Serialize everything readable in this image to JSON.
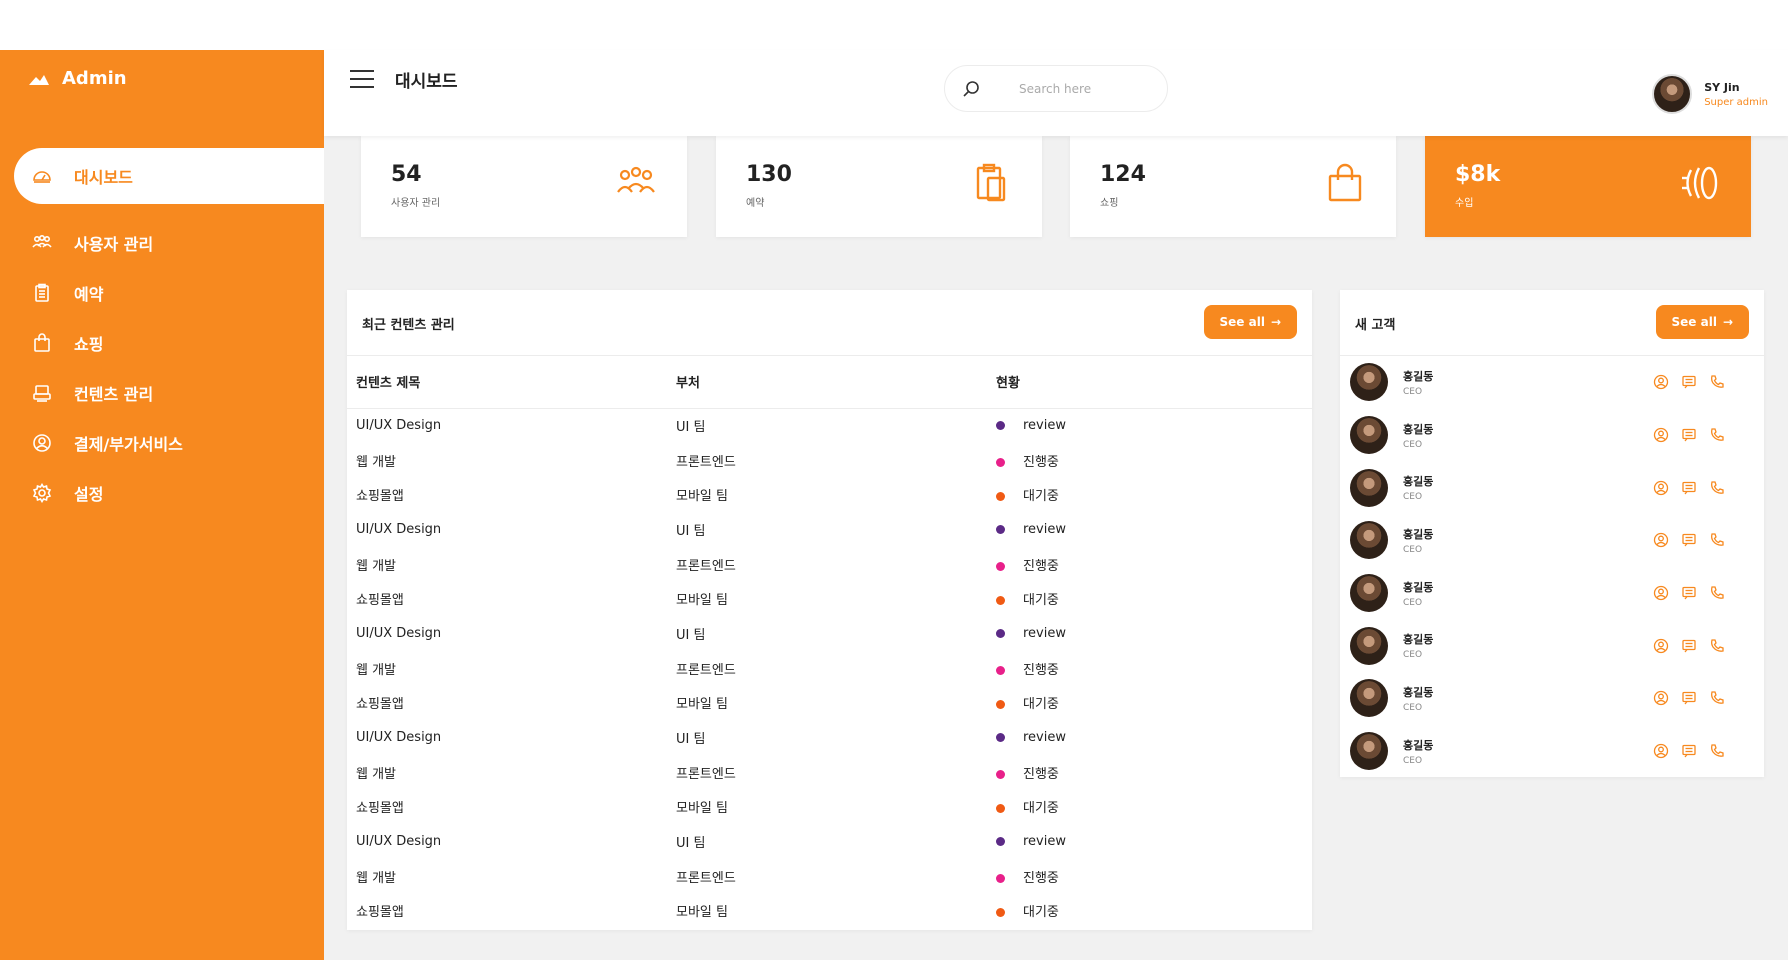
{
  "brand": {
    "name": "Admin"
  },
  "sidebar": {
    "items": [
      {
        "label": "대시보드",
        "icon": "dashboard-icon",
        "active": true
      },
      {
        "label": "사용자 관리",
        "icon": "users-icon"
      },
      {
        "label": "예약",
        "icon": "clipboard-icon"
      },
      {
        "label": "쇼핑",
        "icon": "shopping-bag-icon"
      },
      {
        "label": "컨텐츠 관리",
        "icon": "content-icon"
      },
      {
        "label": "결제/부가서비스",
        "icon": "user-circle-icon"
      },
      {
        "label": "설정",
        "icon": "gear-icon"
      }
    ]
  },
  "header": {
    "title": "대시보드",
    "search_placeholder": "Search here",
    "user_name": "SY Jin",
    "user_role": "Super admin"
  },
  "cards": [
    {
      "value": "54",
      "label": "사용자 관리",
      "icon": "users-icon"
    },
    {
      "value": "130",
      "label": "예약",
      "icon": "clipboard-icon"
    },
    {
      "value": "124",
      "label": "쇼핑",
      "icon": "shopping-bag-icon"
    },
    {
      "value": "$8k",
      "label": "수입",
      "icon": "coins-icon"
    }
  ],
  "recent": {
    "title": "최근 컨텐츠 관리",
    "see_all": "See all",
    "columns": [
      "컨텐츠 제목",
      "부처",
      "현황"
    ],
    "rows": [
      {
        "title": "UI/UX Design",
        "dept": "UI 팀",
        "status": "review",
        "color": "#5b2a86"
      },
      {
        "title": "웹 개발",
        "dept": "프론트엔드",
        "status": "진행중",
        "color": "#e8208a"
      },
      {
        "title": "쇼핑몰앱",
        "dept": "모바일 팀",
        "status": "대기중",
        "color": "#f05a14"
      },
      {
        "title": "UI/UX Design",
        "dept": "UI 팀",
        "status": "review",
        "color": "#5b2a86"
      },
      {
        "title": "웹 개발",
        "dept": "프론트엔드",
        "status": "진행중",
        "color": "#e8208a"
      },
      {
        "title": "쇼핑몰앱",
        "dept": "모바일 팀",
        "status": "대기중",
        "color": "#f05a14"
      },
      {
        "title": "UI/UX Design",
        "dept": "UI 팀",
        "status": "review",
        "color": "#5b2a86"
      },
      {
        "title": "웹 개발",
        "dept": "프론트엔드",
        "status": "진행중",
        "color": "#e8208a"
      },
      {
        "title": "쇼핑몰앱",
        "dept": "모바일 팀",
        "status": "대기중",
        "color": "#f05a14"
      },
      {
        "title": "UI/UX Design",
        "dept": "UI 팀",
        "status": "review",
        "color": "#5b2a86"
      },
      {
        "title": "웹 개발",
        "dept": "프론트엔드",
        "status": "진행중",
        "color": "#e8208a"
      },
      {
        "title": "쇼핑몰앱",
        "dept": "모바일 팀",
        "status": "대기중",
        "color": "#f05a14"
      },
      {
        "title": "UI/UX Design",
        "dept": "UI 팀",
        "status": "review",
        "color": "#5b2a86"
      },
      {
        "title": "웹 개발",
        "dept": "프론트엔드",
        "status": "진행중",
        "color": "#e8208a"
      },
      {
        "title": "쇼핑몰앱",
        "dept": "모바일 팀",
        "status": "대기중",
        "color": "#f05a14"
      }
    ]
  },
  "customers": {
    "title": "새 고객",
    "see_all": "See all",
    "items": [
      {
        "name": "홍길동",
        "title": "CEO"
      },
      {
        "name": "홍길동",
        "title": "CEO"
      },
      {
        "name": "홍길동",
        "title": "CEO"
      },
      {
        "name": "홍길동",
        "title": "CEO"
      },
      {
        "name": "홍길동",
        "title": "CEO"
      },
      {
        "name": "홍길동",
        "title": "CEO"
      },
      {
        "name": "홍길동",
        "title": "CEO"
      },
      {
        "name": "홍길동",
        "title": "CEO"
      }
    ]
  },
  "colors": {
    "accent": "#f7891f",
    "review": "#5b2a86",
    "in_progress": "#e8208a",
    "waiting": "#f05a14"
  }
}
